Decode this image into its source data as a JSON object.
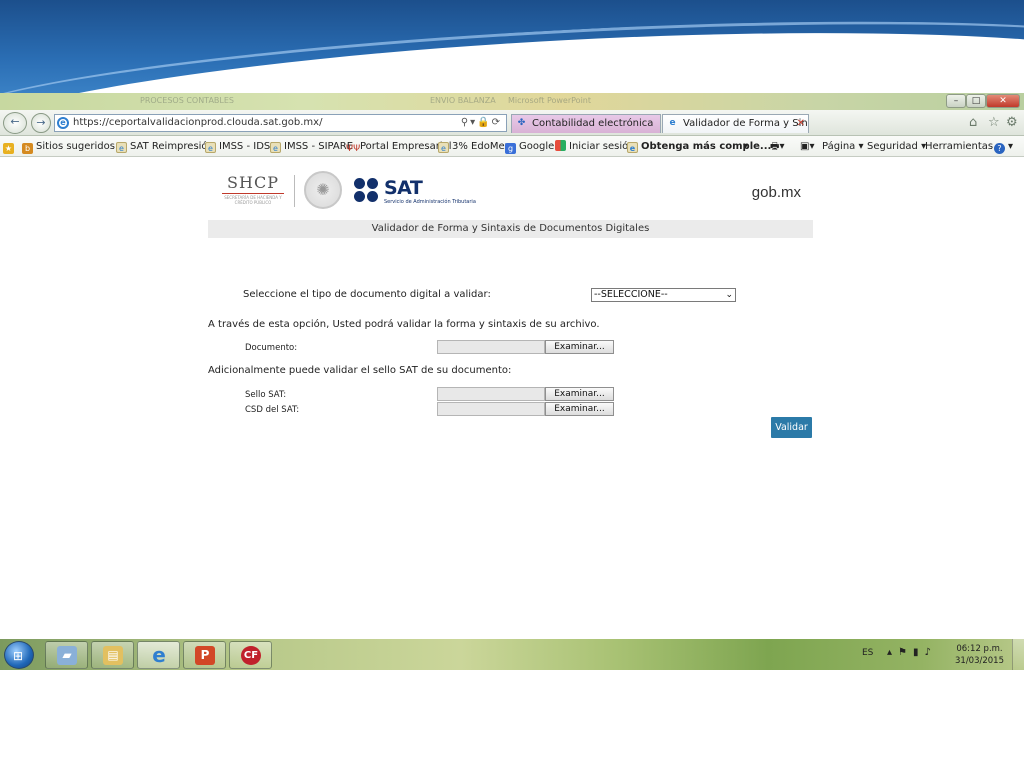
{
  "browser": {
    "ghost_titles": [
      "PROCESOS CONTABLES",
      "ENVIO BALANZA",
      "Microsoft PowerPoint"
    ],
    "address_url": "https://ceportalvalidacionprod.clouda.sat.gob.mx/",
    "tabs": [
      {
        "label": "Contabilidad electrónica"
      },
      {
        "label": "Validador de Forma y Sintax..."
      }
    ],
    "tab_close": "✕"
  },
  "favorites": {
    "items": [
      {
        "label": "Sitios sugeridos ▾"
      },
      {
        "label": "SAT Reimpresión"
      },
      {
        "label": "IMSS - IDSE"
      },
      {
        "label": "IMSS - SIPARE"
      },
      {
        "label": "Portal Empresarial"
      },
      {
        "label": "3% EdoMex"
      },
      {
        "label": "Google"
      },
      {
        "label": "Iniciar sesión"
      },
      {
        "label": "Obtenga más comple..."
      }
    ],
    "more": "▾",
    "commands": {
      "page": "Página ▾",
      "security": "Seguridad ▾",
      "tools": "Herramientas ▾"
    }
  },
  "header": {
    "shcp": "SHCP",
    "shcp_sub": "SECRETARÍA DE HACIENDA Y CRÉDITO PÚBLICO",
    "sat": "SAT",
    "sat_sub": "Servicio de Administración Tributaria",
    "gobmx": "gob.mx",
    "title": "Validador de Forma y Sintaxis de Documentos Digitales"
  },
  "form": {
    "select_label": "Seleccione el tipo de documento digital a validar:",
    "select_value": "--SELECCIONE--",
    "info_text": "A través de esta opción, Usted podrá validar la forma y sintaxis de su archivo.",
    "documento_label": "Documento:",
    "additional_text": "Adicionalmente puede validar el sello SAT de su documento:",
    "sello_label": "Sello SAT:",
    "csd_label": "CSD del SAT:",
    "browse_label": "Examinar...",
    "validate_label": "Validar"
  },
  "taskbar": {
    "lang": "ES",
    "time": "06:12 p.m.",
    "date": "31/03/2015",
    "cf_label": "CF"
  },
  "colors": {
    "sat_blue": "#12306b",
    "validate_blue": "#2b7aa8"
  }
}
